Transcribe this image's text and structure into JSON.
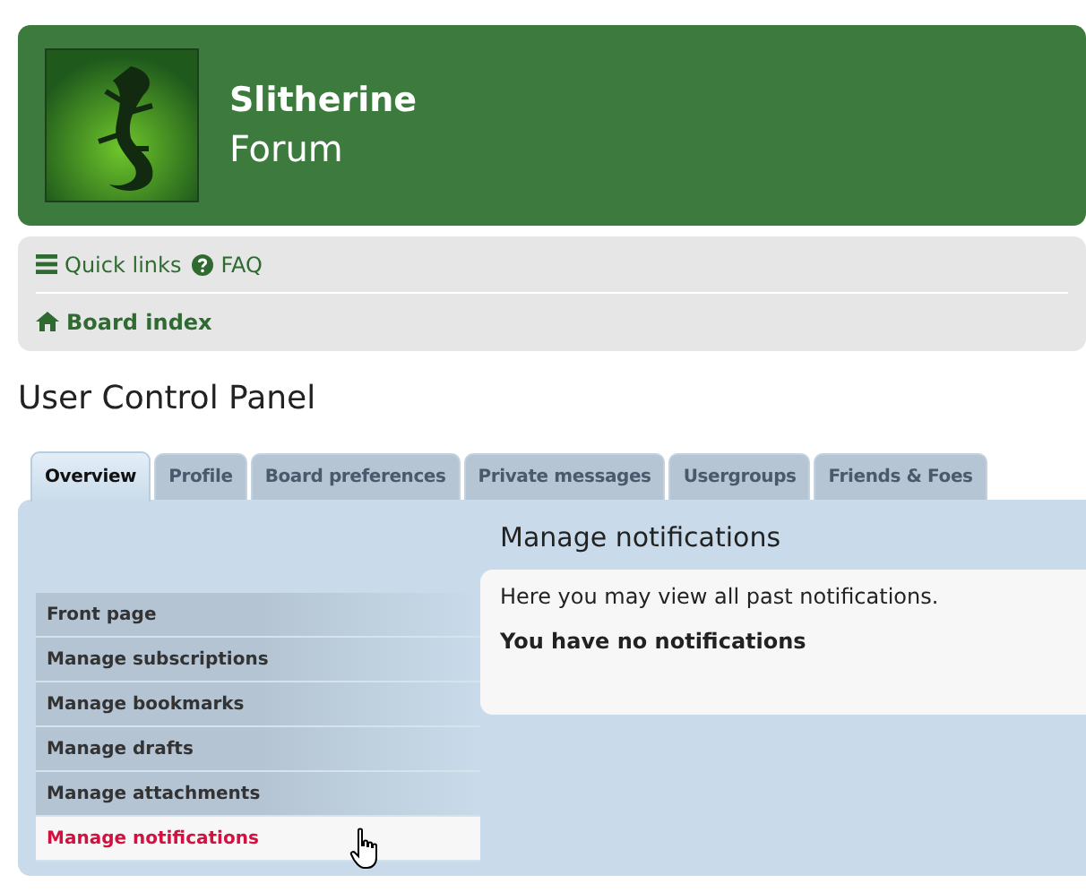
{
  "site": {
    "name": "Slitherine",
    "subtitle": "Forum"
  },
  "navbar": {
    "links": [
      {
        "kind": "menu",
        "label": "Quick links"
      },
      {
        "kind": "help",
        "label": "FAQ"
      }
    ],
    "breadcrumb": "Board index"
  },
  "page_title": "User Control Panel",
  "tabs": [
    {
      "label": "Overview",
      "selected": true
    },
    {
      "label": "Profile",
      "selected": false
    },
    {
      "label": "Board preferences",
      "selected": false
    },
    {
      "label": "Private messages",
      "selected": false
    },
    {
      "label": "Usergroups",
      "selected": false
    },
    {
      "label": "Friends & Foes",
      "selected": false
    }
  ],
  "sidebar": {
    "items": [
      {
        "label": "Front page",
        "selected": false
      },
      {
        "label": "Manage subscriptions",
        "selected": false
      },
      {
        "label": "Manage bookmarks",
        "selected": false
      },
      {
        "label": "Manage drafts",
        "selected": false
      },
      {
        "label": "Manage attachments",
        "selected": false
      },
      {
        "label": "Manage notifications",
        "selected": true
      }
    ]
  },
  "content": {
    "title": "Manage notifications",
    "description": "Here you may view all past notifications.",
    "message": "You have no notifications"
  }
}
